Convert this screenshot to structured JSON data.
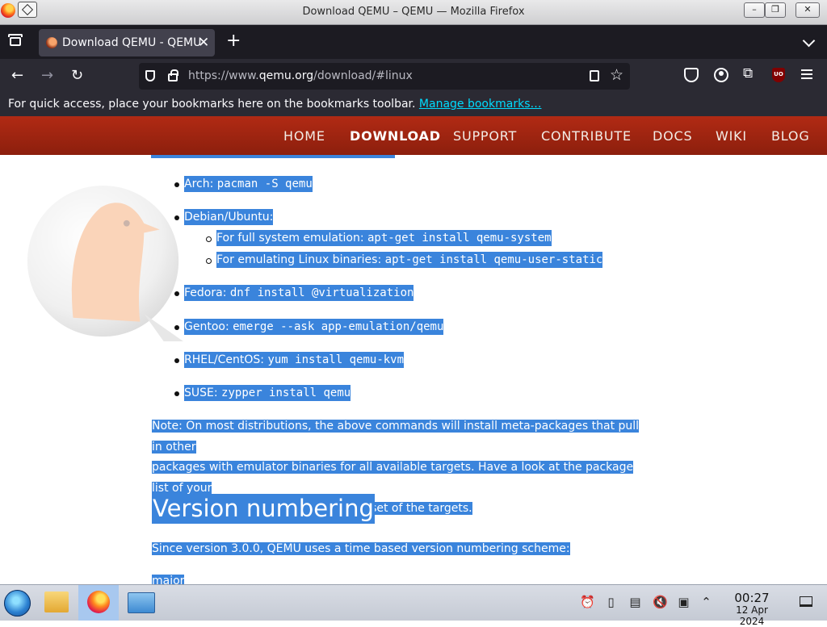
{
  "window": {
    "title": "Download QEMU – QEMU — Mozilla Firefox",
    "buttons": {
      "minimize": "–",
      "maximize": "❐",
      "close": "✕"
    }
  },
  "tabs": [
    {
      "label": "Download QEMU - QEMU",
      "close": "✕"
    }
  ],
  "tabstrip": {
    "new_tab": "+"
  },
  "navbar": {
    "back": "←",
    "forward": "→",
    "reload": "↻",
    "url_prefix": "https://www.",
    "url_host": "qemu.org",
    "url_path": "/download/#linux",
    "bookmark_star": "☆",
    "extension": "⧉",
    "ublock": "UO"
  },
  "bookmarks_bar": {
    "message": "For quick access, place your bookmarks here on the bookmarks toolbar. ",
    "manage_link": "Manage bookmarks…"
  },
  "site_nav": [
    {
      "label": "HOME",
      "active": false
    },
    {
      "label": "DOWNLOAD",
      "active": true
    },
    {
      "label": "SUPPORT",
      "active": false
    },
    {
      "label": "CONTRIBUTE",
      "active": false
    },
    {
      "label": "DOCS",
      "active": false
    },
    {
      "label": "WIKI",
      "active": false
    },
    {
      "label": "BLOG",
      "active": false
    }
  ],
  "content": {
    "packages": [
      {
        "distro": "Arch:",
        "command": "pacman -S qemu"
      },
      {
        "distro": "Debian/Ubuntu:",
        "command": ""
      },
      {
        "distro": "Fedora:",
        "command": "dnf install @virtualization"
      },
      {
        "distro": "Gentoo:",
        "command": "emerge --ask app-emulation/qemu"
      },
      {
        "distro": "RHEL/CentOS:",
        "command": "yum install qemu-kvm"
      },
      {
        "distro": "SUSE:",
        "command": "zypper install qemu"
      }
    ],
    "debian_sub": [
      {
        "text": "For full system emulation: ",
        "command": "apt-get install qemu-system"
      },
      {
        "text": "For emulating Linux binaries: ",
        "command": "apt-get install qemu-user-static"
      }
    ],
    "note_lines": [
      "Note: On most distributions, the above commands will install meta-packages that pull in other",
      "packages with emulator binaries for all available targets. Have a look at the package list of your",
      "distribution first if you only need a subset of the targets."
    ],
    "heading": "Version numbering",
    "version_para": "Since version 3.0.0, QEMU uses a time based version numbering scheme:",
    "cut_off_text": "major"
  },
  "taskbar": {
    "clock_time": "00:27",
    "clock_date": "12 Apr 2024",
    "tray_icons": [
      "notifications-icon",
      "battery-icon",
      "clipboard-icon",
      "volume-muted-icon",
      "keyboard-layout-icon",
      "tray-expand-icon"
    ]
  },
  "colors": {
    "selection": "#3a84dc",
    "site_header": "#a02512",
    "browser_chrome": "#2b2a33",
    "manage_link": "#00ddff"
  }
}
